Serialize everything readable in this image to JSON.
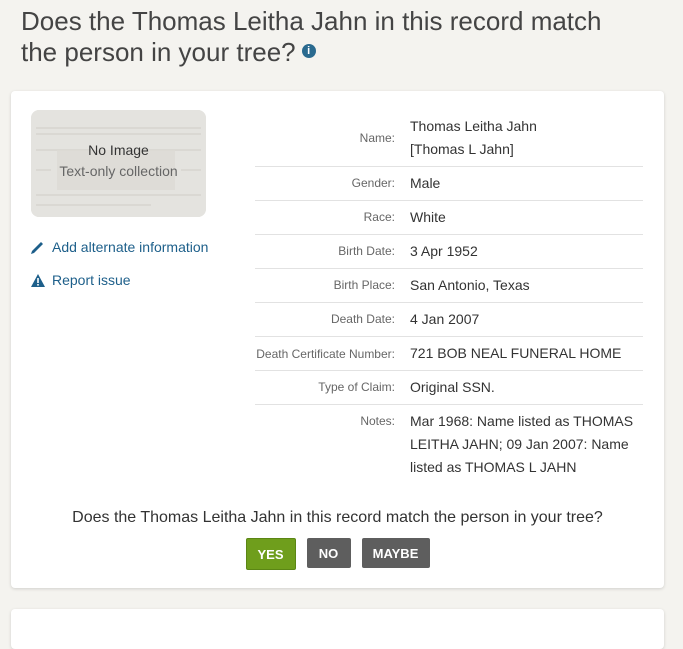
{
  "page": {
    "title": "Does the Thomas Leitha Jahn in this record match the person in your tree?",
    "info_icon": "info-icon"
  },
  "image_panel": {
    "no_image": "No Image",
    "subtitle": "Text-only collection"
  },
  "side_links": {
    "add_alternate": "Add alternate information",
    "report_issue": "Report issue"
  },
  "facts": [
    {
      "label": "Name:",
      "value": "Thomas Leitha Jahn",
      "value2": "[Thomas L Jahn]"
    },
    {
      "label": "Gender:",
      "value": "Male"
    },
    {
      "label": "Race:",
      "value": "White"
    },
    {
      "label": "Birth Date:",
      "value": "3 Apr 1952"
    },
    {
      "label": "Birth Place:",
      "value": "San Antonio, Texas"
    },
    {
      "label": "Death Date:",
      "value": "4 Jan 2007"
    },
    {
      "label": "Death Certificate Number:",
      "value": "721 BOB NEAL FUNERAL HOME"
    },
    {
      "label": "Type of Claim:",
      "value": "Original SSN."
    },
    {
      "label": "Notes:",
      "value": "Mar 1968: Name listed as THOMAS LEITHA JAHN; 09 Jan 2007: Name listed as THOMAS L JAHN"
    }
  ],
  "match": {
    "question": "Does the Thomas Leitha Jahn in this record match the person in your tree?",
    "yes": "YES",
    "no": "NO",
    "maybe": "MAYBE"
  },
  "colors": {
    "link": "#1d5f8a",
    "yes_button": "#6f9e1c",
    "neutral_button": "#5e5e5e"
  }
}
